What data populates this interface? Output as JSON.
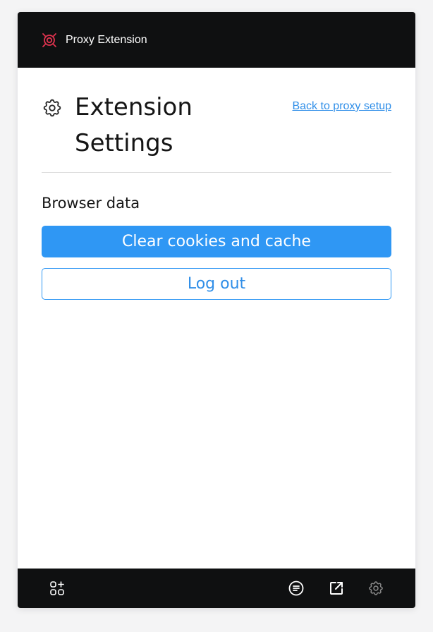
{
  "header": {
    "title": "Proxy Extension",
    "brand_color": "#e0334f"
  },
  "page": {
    "title": "Extension Settings",
    "back_link": "Back to proxy setup"
  },
  "browser_data": {
    "section_title": "Browser data",
    "clear_button": "Clear cookies and cache",
    "logout_button": "Log out"
  },
  "footer": {
    "icons": [
      "apps-add-icon",
      "list-icon",
      "external-link-icon",
      "settings-icon"
    ],
    "active_icon": "settings-icon"
  },
  "colors": {
    "accent": "#2f97f4",
    "bar": "#0f1011"
  }
}
